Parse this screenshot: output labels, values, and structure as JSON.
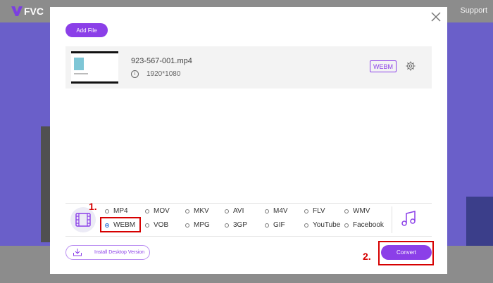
{
  "header": {
    "brand": "FVC",
    "support": "Support"
  },
  "modal": {
    "add_file": "Add File",
    "file": {
      "name": "923-567-001.mp4",
      "resolution": "1920*1080",
      "format": "WEBM"
    },
    "formats": [
      {
        "label": "MP4",
        "selected": false
      },
      {
        "label": "MOV",
        "selected": false
      },
      {
        "label": "MKV",
        "selected": false
      },
      {
        "label": "AVI",
        "selected": false
      },
      {
        "label": "M4V",
        "selected": false
      },
      {
        "label": "FLV",
        "selected": false
      },
      {
        "label": "WMV",
        "selected": false
      },
      {
        "label": "WEBM",
        "selected": true
      },
      {
        "label": "VOB",
        "selected": false
      },
      {
        "label": "MPG",
        "selected": false
      },
      {
        "label": "3GP",
        "selected": false
      },
      {
        "label": "GIF",
        "selected": false
      },
      {
        "label": "YouTube",
        "selected": false
      },
      {
        "label": "Facebook",
        "selected": false
      }
    ],
    "install": "Install Desktop Version",
    "convert": "Convert"
  },
  "annotations": {
    "step1": "1.",
    "step2": "2."
  },
  "colors": {
    "accent": "#8b3fe8",
    "annotation": "#d60000"
  },
  "icons": [
    "close-icon",
    "gear-icon",
    "info-icon",
    "film-icon",
    "music-icon",
    "download-icon"
  ]
}
